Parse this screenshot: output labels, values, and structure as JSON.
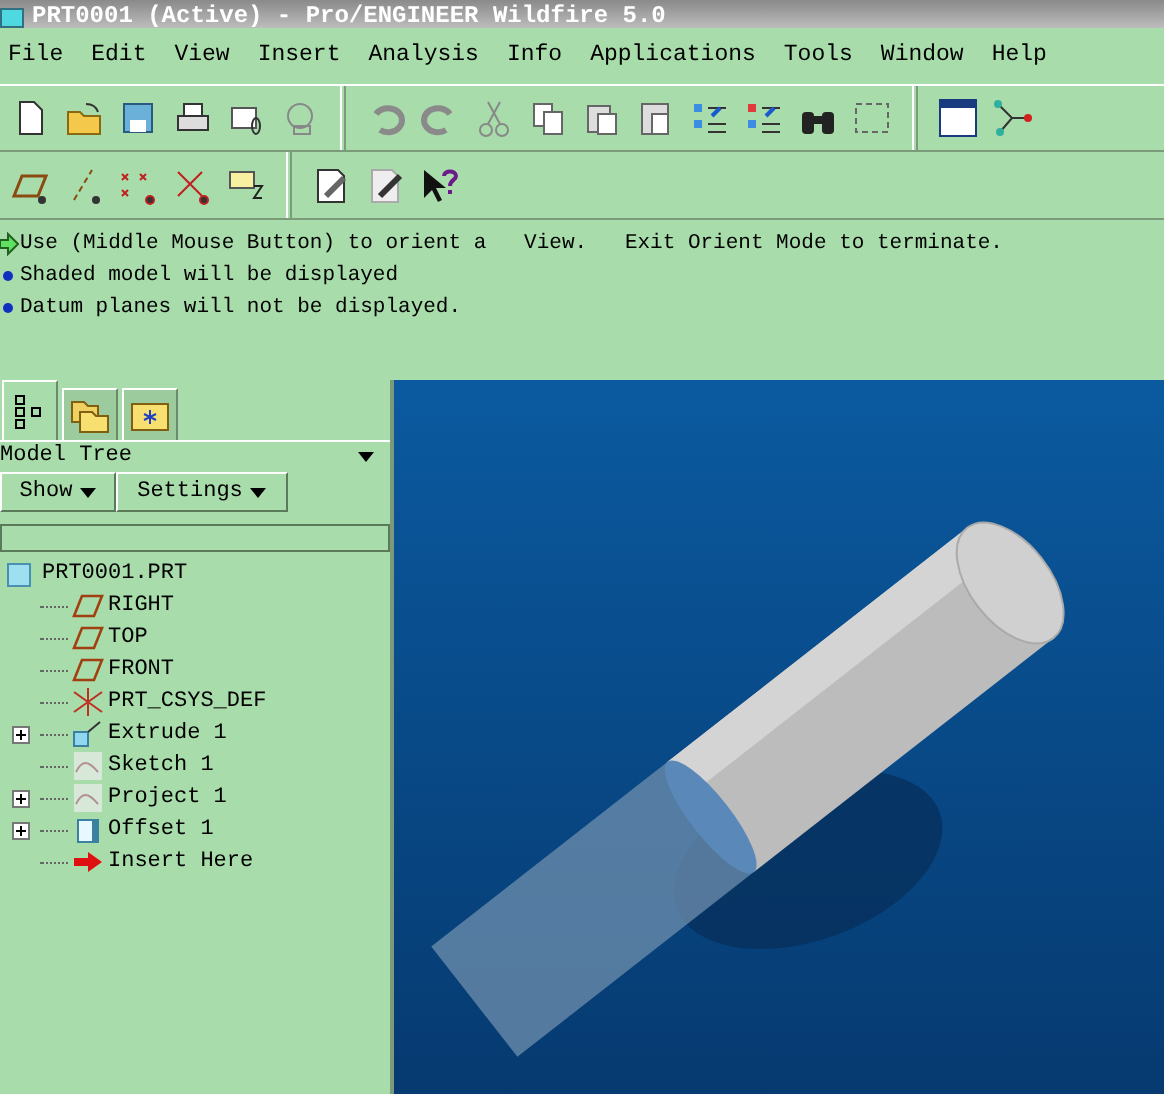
{
  "window": {
    "title": "PRT0001 (Active) - Pro/ENGINEER Wildfire 5.0"
  },
  "menu": [
    "File",
    "Edit",
    "View",
    "Insert",
    "Analysis",
    "Info",
    "Applications",
    "Tools",
    "Window",
    "Help"
  ],
  "messages": [
    {
      "kind": "prompt",
      "text": "Use (Middle Mouse Button) to orient a   View.   Exit Orient Mode to terminate."
    },
    {
      "kind": "info",
      "text": "Shaded model will be displayed"
    },
    {
      "kind": "info",
      "text": "Datum planes will not be displayed."
    }
  ],
  "navigator": {
    "tabs": [
      {
        "kind": "tree",
        "selected": true
      },
      {
        "kind": "folders",
        "selected": false
      },
      {
        "kind": "favorites",
        "selected": false
      }
    ],
    "title": "Model Tree",
    "buttons": [
      "Show",
      "Settings"
    ],
    "tree": {
      "label": "PRT0001.PRT",
      "kind": "part",
      "children": [
        {
          "label": "RIGHT",
          "kind": "plane",
          "expandable": false
        },
        {
          "label": "TOP",
          "kind": "plane",
          "expandable": false
        },
        {
          "label": "FRONT",
          "kind": "plane",
          "expandable": false
        },
        {
          "label": "PRT_CSYS_DEF",
          "kind": "csys",
          "expandable": false
        },
        {
          "label": "Extrude 1",
          "kind": "extrude",
          "expandable": true
        },
        {
          "label": "Sketch 1",
          "kind": "sketch",
          "expandable": false
        },
        {
          "label": "Project 1",
          "kind": "sketch",
          "expandable": true
        },
        {
          "label": "Offset 1",
          "kind": "solid",
          "expandable": true
        },
        {
          "label": "Insert Here",
          "kind": "insert",
          "expandable": false
        }
      ]
    }
  }
}
